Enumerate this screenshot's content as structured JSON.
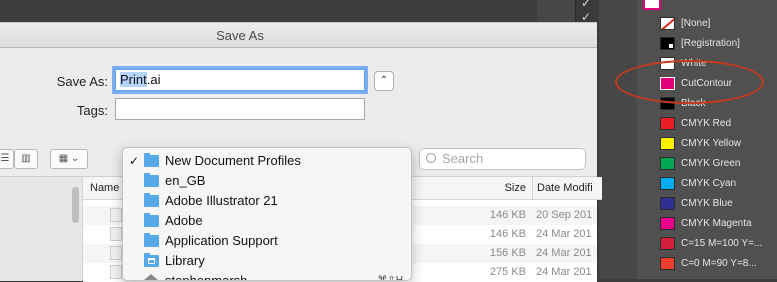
{
  "dialog": {
    "title": "Save As",
    "save_as_label": "Save As:",
    "filename_selected": "Print",
    "filename_rest": ".ai",
    "tags_label": "Tags:",
    "tags_value": "",
    "collapse_glyph": "⌃",
    "search_placeholder": "Search"
  },
  "toolbar": {
    "view_columns_icon": "columns-view-icon",
    "arrange_icon": "arrange-icon"
  },
  "location_popup": {
    "items": [
      {
        "label": "New Document Profiles",
        "checked": true,
        "icon": "folder-icon"
      },
      {
        "label": "en_GB",
        "checked": false,
        "icon": "folder-icon"
      },
      {
        "label": "Adobe Illustrator 21",
        "checked": false,
        "icon": "folder-icon"
      },
      {
        "label": "Adobe",
        "checked": false,
        "icon": "folder-icon"
      },
      {
        "label": "Application Support",
        "checked": false,
        "icon": "folder-icon"
      },
      {
        "label": "Library",
        "checked": false,
        "icon": "library-folder-icon"
      },
      {
        "label": "stephenmarsh",
        "checked": false,
        "icon": "home-icon",
        "right": "⌘⇧H"
      }
    ],
    "check_glyph": "✓"
  },
  "file_list": {
    "columns": [
      "Name",
      "Size",
      "Date Modifi"
    ],
    "rows": [
      {
        "size": "146 KB",
        "date": "20 Sep 201"
      },
      {
        "size": "146 KB",
        "date": "24 Mar 201"
      },
      {
        "size": "156 KB",
        "date": "24 Mar 201"
      },
      {
        "size": "275 KB",
        "date": "24 Mar 201"
      }
    ]
  },
  "swatches": {
    "items": [
      {
        "name": "[None]",
        "color": "#ffffff",
        "kind": "none"
      },
      {
        "name": "[Registration]",
        "color": "#000000",
        "kind": "reg"
      },
      {
        "name": "White",
        "color": "#ffffff",
        "kind": "plain"
      },
      {
        "name": "CutContour",
        "color": "#e2007a",
        "kind": "spot"
      },
      {
        "name": "Black",
        "color": "#000000",
        "kind": "plain"
      },
      {
        "name": "CMYK Red",
        "color": "#ec1c24",
        "kind": "plain"
      },
      {
        "name": "CMYK Yellow",
        "color": "#fff200",
        "kind": "plain"
      },
      {
        "name": "CMYK Green",
        "color": "#00a651",
        "kind": "plain"
      },
      {
        "name": "CMYK Cyan",
        "color": "#00aeef",
        "kind": "plain"
      },
      {
        "name": "CMYK Blue",
        "color": "#2e3192",
        "kind": "plain"
      },
      {
        "name": "CMYK Magenta",
        "color": "#ec008c",
        "kind": "plain"
      },
      {
        "name": "C=15 M=100 Y=...",
        "color": "#cf1f3b",
        "kind": "plain"
      },
      {
        "name": "C=0 M=90 Y=8...",
        "color": "#ee3e2f",
        "kind": "plain"
      }
    ],
    "highlight_color": "#c63a1f"
  }
}
